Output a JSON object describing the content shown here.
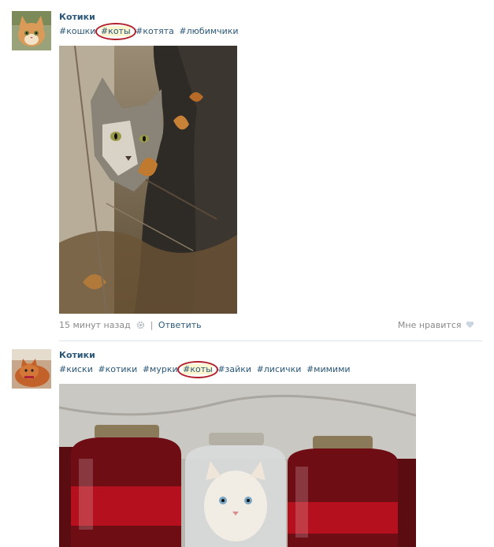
{
  "posts": [
    {
      "author": "Котики",
      "tags": [
        "#кошки",
        "#коты",
        "#котята",
        "#любимчики"
      ],
      "highlighted_tag": 1,
      "time": "15 минут назад",
      "reply_label": "Ответить",
      "like_label": "Мне нравится"
    },
    {
      "author": "Котики",
      "tags": [
        "#киски",
        "#котики",
        "#мурки",
        "#коты",
        "#зайки",
        "#лисички",
        "#мимими"
      ],
      "highlighted_tag": 3
    }
  ],
  "colors": {
    "link": "#2b587a",
    "highlight_ring": "#b01e2a",
    "meta": "#8a8a8a"
  },
  "icons": {
    "settings": "gear-icon",
    "like": "heart-icon"
  }
}
